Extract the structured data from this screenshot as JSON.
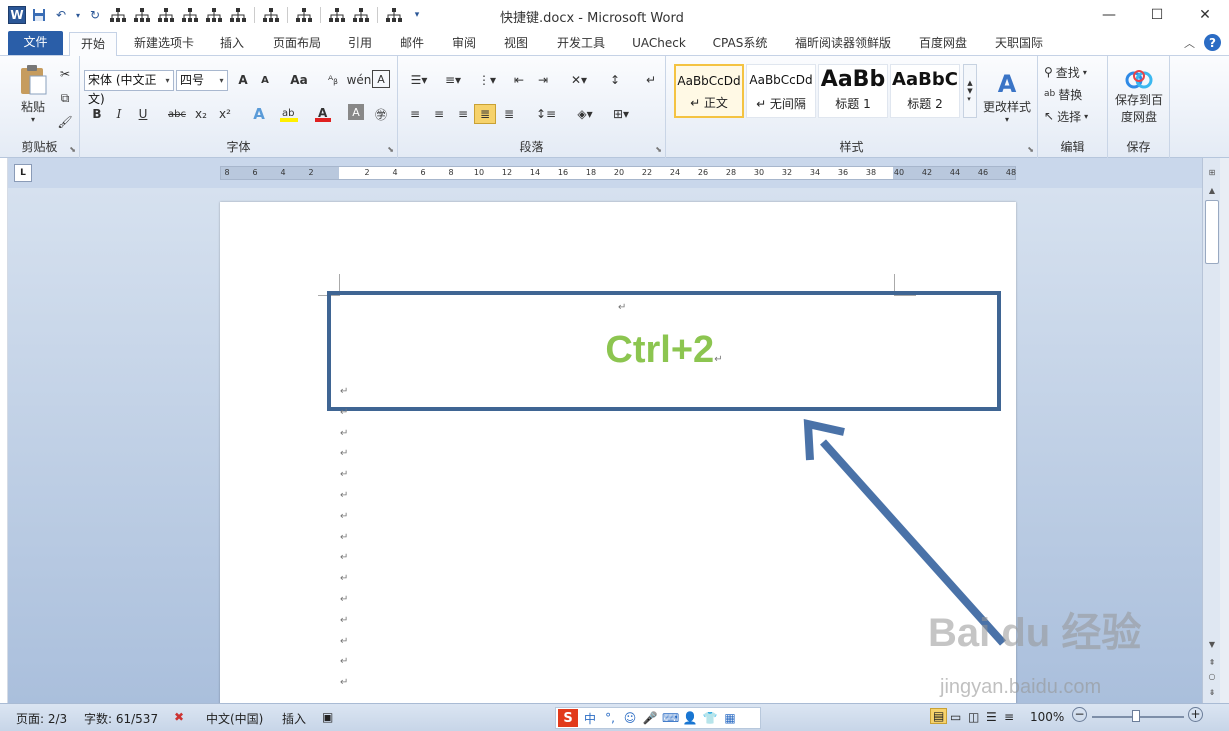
{
  "window": {
    "title": "快捷键.docx - Microsoft Word",
    "minimize": "—",
    "maximize": "☐",
    "close": "✕"
  },
  "quick_access": {
    "app_letter": "W",
    "icons": [
      "word-app-icon",
      "save-icon",
      "undo-icon",
      "redo-icon",
      "org-chart-icon",
      "customize-qat-icon"
    ]
  },
  "tabs": [
    "文件",
    "开始",
    "新建选项卡",
    "插入",
    "页面布局",
    "引用",
    "邮件",
    "审阅",
    "视图",
    "开发工具",
    "UACheck",
    "CPAS系统",
    "福昕阅读器领鲜版",
    "百度网盘",
    "天职国际"
  ],
  "help_label": "?",
  "ribbon": {
    "clipboard": {
      "paste_label": "粘贴",
      "group_label": "剪贴板"
    },
    "font": {
      "font_name": "宋体 (中文正文)",
      "font_size": "四号",
      "bold": "B",
      "italic": "I",
      "underline": "U",
      "strike": "abc",
      "subscript": "x₂",
      "superscript": "x²",
      "grow": "A",
      "shrink": "A",
      "change_case": "Aa",
      "group_label": "字体"
    },
    "paragraph": {
      "group_label": "段落"
    },
    "styles": {
      "items": [
        {
          "preview": "AaBbCcDd",
          "name": "↵ 正文"
        },
        {
          "preview": "AaBbCcDd",
          "name": "↵ 无间隔"
        },
        {
          "preview": "AaBb",
          "name": "标题 1"
        },
        {
          "preview": "AaBbC",
          "name": "标题 2"
        }
      ],
      "change_styles_label": "更改样式",
      "group_label": "样式"
    },
    "editing": {
      "find_label": "查找",
      "replace_label": "替换",
      "select_label": "选择",
      "group_label": "编辑"
    },
    "save": {
      "save_to_baidu_label": "保存到百度网盘",
      "group_label": "保存"
    }
  },
  "ruler": {
    "tab_selector": "L",
    "numbers": [
      "8",
      "6",
      "4",
      "2",
      "2",
      "4",
      "6",
      "8",
      "10",
      "12",
      "14",
      "16",
      "18",
      "20",
      "22",
      "24",
      "26",
      "28",
      "30",
      "32",
      "34",
      "36",
      "38",
      "40",
      "42",
      "44",
      "46",
      "48"
    ]
  },
  "document": {
    "heading_text": "Ctrl+2",
    "paragraph_mark": "↵",
    "annotation": {
      "box_color": "#3f6593",
      "arrow_color": "#4a72a8",
      "text_color": "#8cc550"
    }
  },
  "watermark": {
    "brand": "Bai du 经验",
    "url": "jingyan.baidu.com"
  },
  "status_bar": {
    "page": "页面: 2/3",
    "words": "字数: 61/537",
    "language": "中文(中国)",
    "mode": "插入",
    "ime_brand": "S",
    "ime_text": "中",
    "zoom": "100%",
    "zoom_out": "−",
    "zoom_in": "+"
  }
}
